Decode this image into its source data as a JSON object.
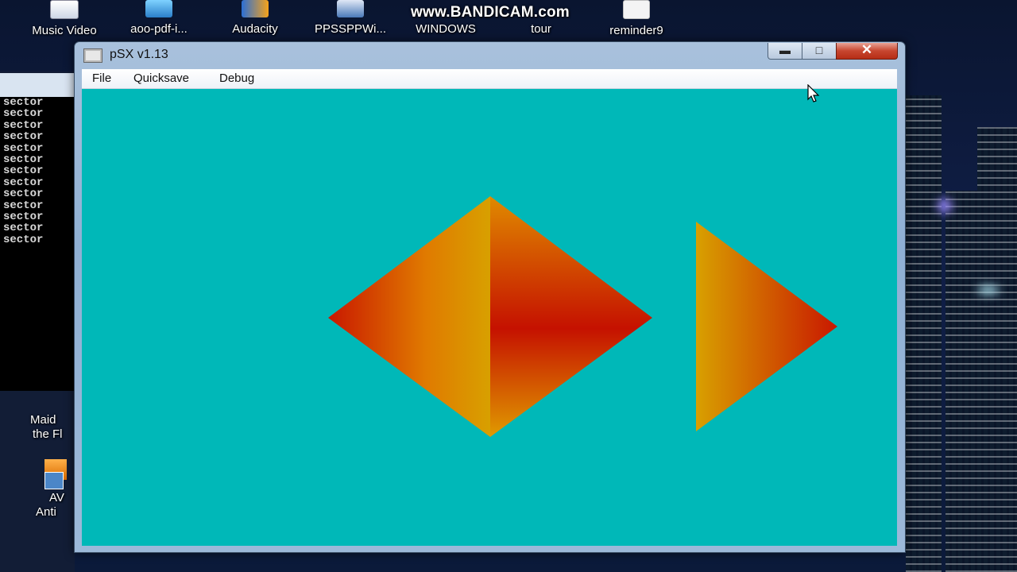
{
  "desktop": {
    "icons": [
      {
        "label": "Music Video",
        "icon": "wav-file-icon"
      },
      {
        "label": "aoo-pdf-i...",
        "icon": "installer-icon"
      },
      {
        "label": "Audacity",
        "icon": "audacity-icon"
      },
      {
        "label": "PPSSPPWi...",
        "icon": "shortcut-icon"
      },
      {
        "label": "WINDOWS",
        "icon": "folder-icon"
      },
      {
        "label": "tour",
        "icon": "shortcut-icon"
      },
      {
        "label": "reminder9",
        "icon": "document-icon"
      }
    ],
    "watermark": "www.BANDICAM.com",
    "left_labels": [
      "Maid",
      "the Fl",
      "AV",
      "Anti"
    ]
  },
  "console": {
    "lines": [
      "sector",
      "sector",
      "sector",
      "sector",
      "sector",
      "sector",
      "sector",
      "sector",
      "sector",
      "sector",
      "sector",
      "sector",
      "sector"
    ]
  },
  "window": {
    "title": "pSX v1.13",
    "menu": [
      "File",
      "Quicksave",
      "Debug"
    ],
    "controls": {
      "minimize": "minimize-icon",
      "maximize": "maximize-icon",
      "close": "close-icon"
    },
    "client_color": "#00b8b8"
  },
  "colors": {
    "shape_red": "#c91800",
    "shape_orange": "#e07a00",
    "shape_gold": "#d8a000"
  }
}
